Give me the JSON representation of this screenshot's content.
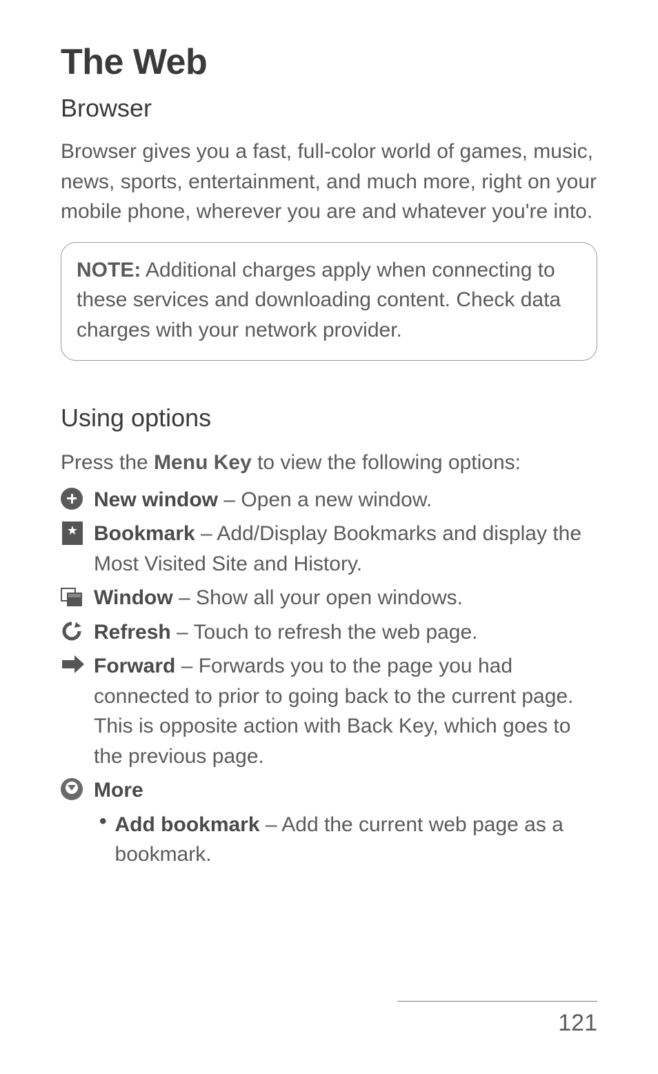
{
  "title": "The Web",
  "section1": {
    "heading": "Browser",
    "intro": "Browser gives you a fast, full-color world of games, music, news, sports, entertainment, and much more, right on your mobile phone, wherever you are and whatever you're into."
  },
  "note": {
    "label": "NOTE:",
    "text": " Additional charges apply when connecting to these services and downloading content. Check data charges with your network provider."
  },
  "section2": {
    "heading": "Using options",
    "press_pre": "Press the ",
    "press_key": "Menu Key",
    "press_post": " to view the following options:"
  },
  "options": {
    "new_window": {
      "label": "New window",
      "desc": " – Open a new window."
    },
    "bookmark": {
      "label": "Bookmark",
      "desc": " – Add/Display Bookmarks and display the Most Visited Site and History."
    },
    "window": {
      "label": "Window",
      "desc": " – Show all your open windows."
    },
    "refresh": {
      "label": "Refresh",
      "desc": " – Touch to refresh the web page."
    },
    "forward": {
      "label": "Forward",
      "desc": " – Forwards you to the page you had connected to prior to going back to the current page. This is opposite action with Back Key, which goes to the previous page."
    },
    "more": {
      "label": "More"
    },
    "add_bookmark": {
      "label": "Add bookmark",
      "desc": " – Add the current web page as a bookmark."
    }
  },
  "page_number": "121"
}
